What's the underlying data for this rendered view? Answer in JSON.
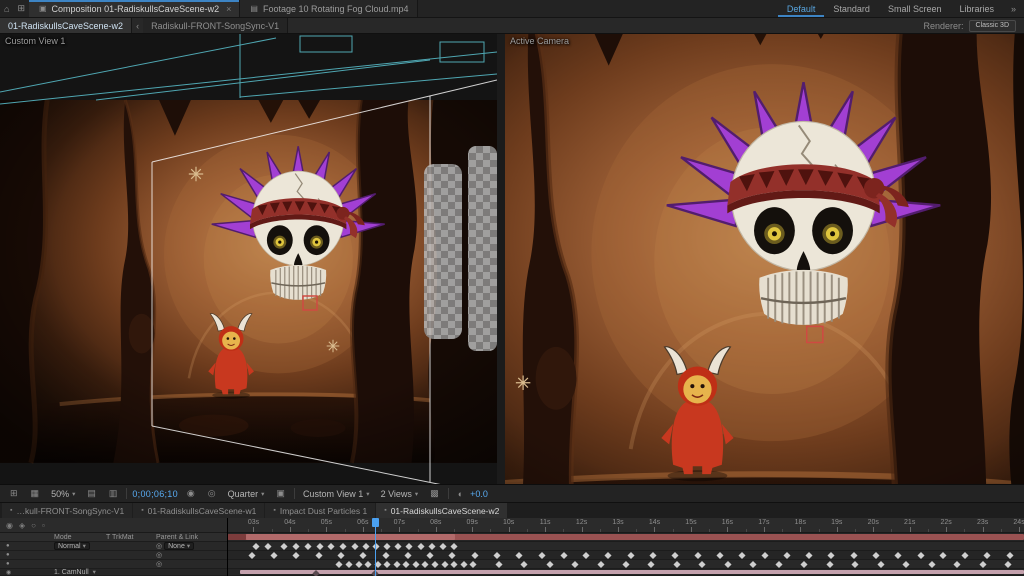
{
  "app_tabs": [
    {
      "label": "Composition 01-RadiskullsCaveScene-w2",
      "close": "×"
    },
    {
      "label": "Footage 10 Rotating Fog Cloud.mp4"
    }
  ],
  "workspace": {
    "items": [
      {
        "label": "Default",
        "active": true
      },
      {
        "label": "Standard"
      },
      {
        "label": "Small Screen"
      },
      {
        "label": "Libraries"
      }
    ],
    "overflow": "»"
  },
  "comp_panel": {
    "back": "‹",
    "tabs": [
      {
        "label": "01-RadiskullsCaveScene-w2",
        "active": true
      },
      {
        "label": "Radiskull-FRONT-SongSync-V1"
      }
    ],
    "renderer_label": "Renderer:",
    "renderer_value": "Classic 3D"
  },
  "viewports": {
    "left_label": "Custom View 1",
    "right_label": "Active Camera"
  },
  "toolbar": {
    "zoom": "50%",
    "timecode": "0;00;06;10",
    "resolution": "Quarter",
    "view": "Custom View 1",
    "layout": "2 Views",
    "exposure": "+0.0"
  },
  "timeline": {
    "tabs": [
      {
        "label": "…kull-FRONT-SongSync-V1"
      },
      {
        "label": "01-RadiskullsCaveScene-w1"
      },
      {
        "label": "Impact Dust Particles 1"
      },
      {
        "label": "01-RadiskullsCaveScene-w2",
        "active": true
      }
    ],
    "columns": {
      "mode": "Mode",
      "trkmat": "T TrkMat",
      "parent": "Parent & Link"
    },
    "row1": {
      "mode": "Normal",
      "parent": "None"
    },
    "bottom_layer": "1. CamNull",
    "ruler": {
      "labels": [
        "03s",
        "04s",
        "05s",
        "06s",
        "07s",
        "08s",
        "09s",
        "10s",
        "11s",
        "12s",
        "13s",
        "14s",
        "15s",
        "16s",
        "17s",
        "18s",
        "19s",
        "20s",
        "21s",
        "22s",
        "23s",
        "24s"
      ],
      "start_pct": 3.2,
      "step_pct": 4.58
    },
    "playhead_pct": 18.5,
    "bar_rows": [
      {
        "track": 0,
        "segments": [
          {
            "from": 0,
            "to": 100,
            "color": "#9a5252"
          },
          {
            "from": 2.2,
            "to": 28.5,
            "color": "#b26a6a"
          },
          {
            "from": 0,
            "to": 2.2,
            "color": "#7c3c3c"
          }
        ]
      },
      {
        "track": 4,
        "segments": [
          {
            "from": 1.5,
            "to": 100,
            "color": "#c4a1ad"
          }
        ]
      }
    ],
    "keyframe_rows": [
      {
        "track": 1,
        "positions": [
          3.5,
          5,
          7,
          8.5,
          10,
          11.5,
          13,
          14.5,
          16,
          17.3,
          18.6,
          20,
          21.4,
          22.8,
          24.2,
          25.6,
          27,
          28.4
        ]
      },
      {
        "track": 2,
        "positions": [
          3,
          5.8,
          8.6,
          11.4,
          14.2,
          17,
          19.8,
          22.6,
          25.4,
          28.2,
          31,
          33.8,
          36.6,
          39.4,
          42.2,
          45,
          47.8,
          50.6,
          53.4,
          56.2,
          59,
          61.8,
          64.6,
          67.4,
          70.2,
          73,
          75.8,
          78.6,
          81.4,
          84.2,
          87,
          89.8,
          92.6,
          95.4,
          98.2
        ]
      },
      {
        "track": 3,
        "positions": [
          14,
          15.2,
          16.4,
          17.6,
          18.8,
          20,
          21.2,
          22.4,
          23.6,
          24.8,
          26,
          27.2,
          28.4,
          29.6,
          30.8,
          34,
          37.2,
          40.4,
          43.6,
          46.8,
          50,
          53.2,
          56.4,
          59.6,
          62.8,
          66,
          69.2,
          72.4,
          75.6,
          78.8,
          82,
          85.2,
          88.4,
          91.6,
          94.8,
          98
        ]
      },
      {
        "track": 4,
        "dark": true,
        "positions": [
          11,
          18.5
        ]
      }
    ]
  },
  "colors": {
    "accent_blue": "#4aa0f0",
    "timecode_blue": "#58abf2",
    "spikes_purple": "#a23fd3",
    "skull_bone": "#ece6d8",
    "bandana_red": "#93302a",
    "cave_glow": "#c8925c",
    "devil_red": "#c8381f",
    "layer_bar_red": "#9a5252",
    "layer_bar_pink": "#c4a1ad",
    "selection_red": "#cf4a42",
    "wireframe_cyan": "#56b7c4"
  }
}
